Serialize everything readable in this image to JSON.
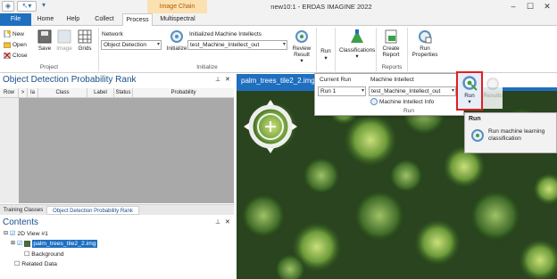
{
  "titlebar": {
    "title": "new10:1 - ERDAS IMAGINE 2022",
    "context_tab": "Image Chain",
    "buttons": [
      "minimize",
      "maximize",
      "close"
    ]
  },
  "tabs": [
    {
      "label": "File",
      "active": false
    },
    {
      "label": "Home",
      "active": false
    },
    {
      "label": "Help",
      "active": false
    },
    {
      "label": "Collect",
      "active": false
    },
    {
      "label": "Process",
      "active": true
    },
    {
      "label": "Multispectral",
      "active": false
    }
  ],
  "ribbon": {
    "project": {
      "group_label": "Project",
      "new": "New",
      "open": "Open",
      "close": "Close",
      "save": "Save",
      "image": "Image",
      "grids": "Grids"
    },
    "initialize": {
      "group_label": "Initialize",
      "network_label": "Network",
      "network_value": "Object Detection",
      "initialize_button": "Initialize",
      "intellects_label": "Initialized Machine Intellects",
      "intellects_value": "test_Machine_Intellect_out",
      "review_result": "Review Result"
    },
    "run_label": "Run",
    "classifications": "Classifications",
    "reports": {
      "group_label": "Reports",
      "create_report": "Create Report"
    },
    "run_properties": "Run Properties"
  },
  "run_panel": {
    "current_run_label": "Current Run",
    "current_run_value": "Run 1",
    "machine_intellect_label": "Machine Intellect",
    "machine_intellect_value": "test_Machine_Intellect_out",
    "info_button": "Machine Intellect Info",
    "group_label": "Run",
    "run_button": "Run",
    "results_button": "Results"
  },
  "tooltip": {
    "title": "Run",
    "text": "Run machine learning classification"
  },
  "left_panel": {
    "title": "Object Detection Probability Rank",
    "columns": [
      "Row",
      ">",
      "Ia",
      "Class",
      "Label",
      "Status",
      "Probability"
    ],
    "tabs": [
      "Training Classes",
      "Object Detection Probability Rank"
    ]
  },
  "contents": {
    "title": "Contents",
    "view": "2D View #1",
    "layer": "palm_trees_tile2_2.img",
    "background": "Background",
    "related": "Related Data"
  },
  "viewer": {
    "tab_label": "palm_trees_tile2_2.img"
  },
  "colors": {
    "accent": "#1f6fc0",
    "highlight": "#e02020",
    "context_tab": "#fbe0b0"
  }
}
